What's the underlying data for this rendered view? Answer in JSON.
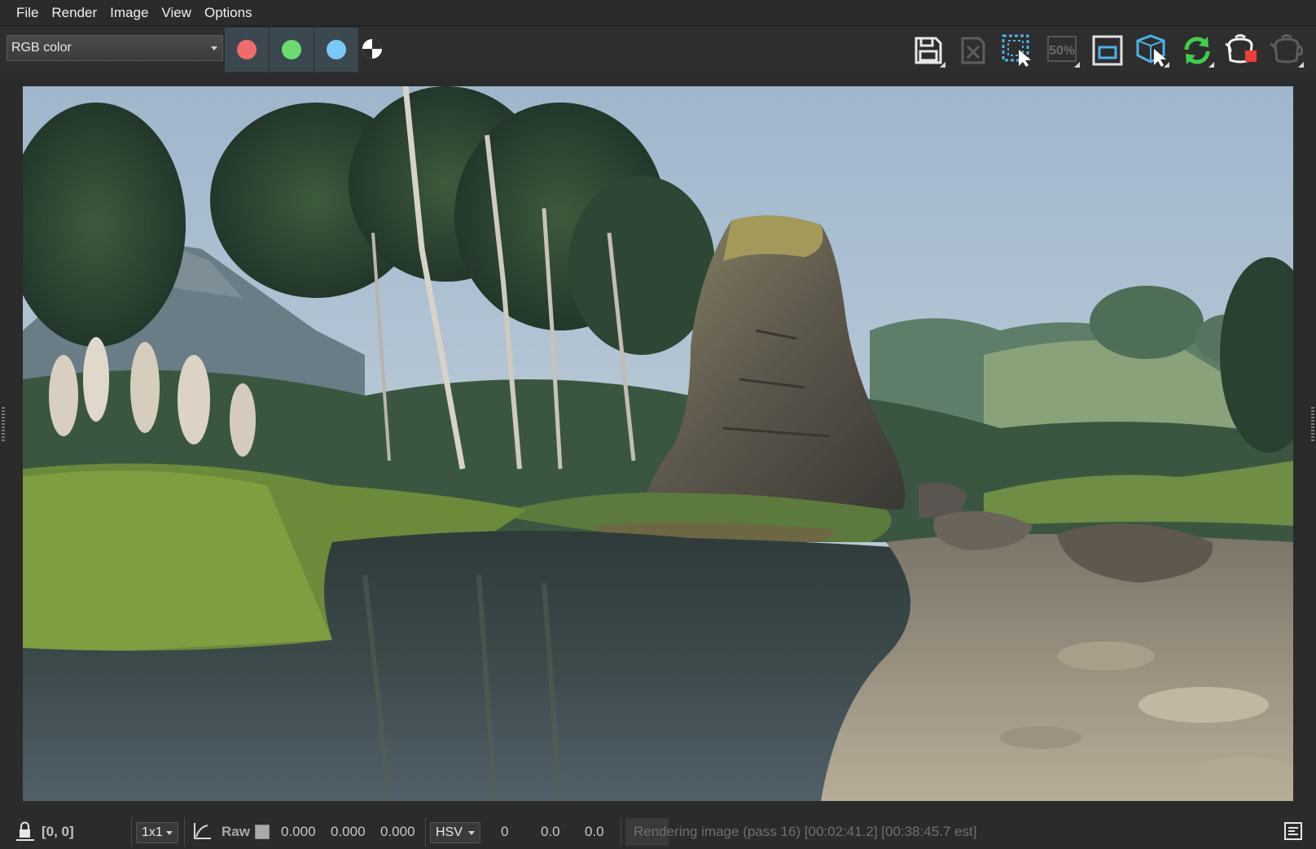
{
  "menu": {
    "items": [
      {
        "label": "File"
      },
      {
        "label": "Render"
      },
      {
        "label": "Image"
      },
      {
        "label": "View"
      },
      {
        "label": "Options"
      }
    ]
  },
  "toolbar": {
    "channel_select": "RGB color",
    "channels": [
      {
        "name": "red-channel",
        "color": "#f06b6b"
      },
      {
        "name": "green-channel",
        "color": "#6ddb6d"
      },
      {
        "name": "blue-channel",
        "color": "#7ac8f5"
      }
    ],
    "zoom_badge": "50%",
    "icons": [
      "save-icon",
      "clear-icon",
      "region-select-icon",
      "zoom-50-icon",
      "fit-frame-icon",
      "track-mouse-icon",
      "refresh-icon",
      "stop-render-icon",
      "teapot-icon"
    ]
  },
  "status": {
    "coords": "[0, 0]",
    "sample": "1x1",
    "raw_label": "Raw",
    "raw_values": [
      "0.000",
      "0.000",
      "0.000"
    ],
    "color_space": "HSV",
    "hsv_values": [
      "0",
      "0.0",
      "0.0"
    ],
    "render_message": "Rendering image (pass 16) [00:02:41.2] [00:38:45.7 est]",
    "render_progress": 0.129
  },
  "viewport": {
    "content": "rendered landscape image"
  }
}
